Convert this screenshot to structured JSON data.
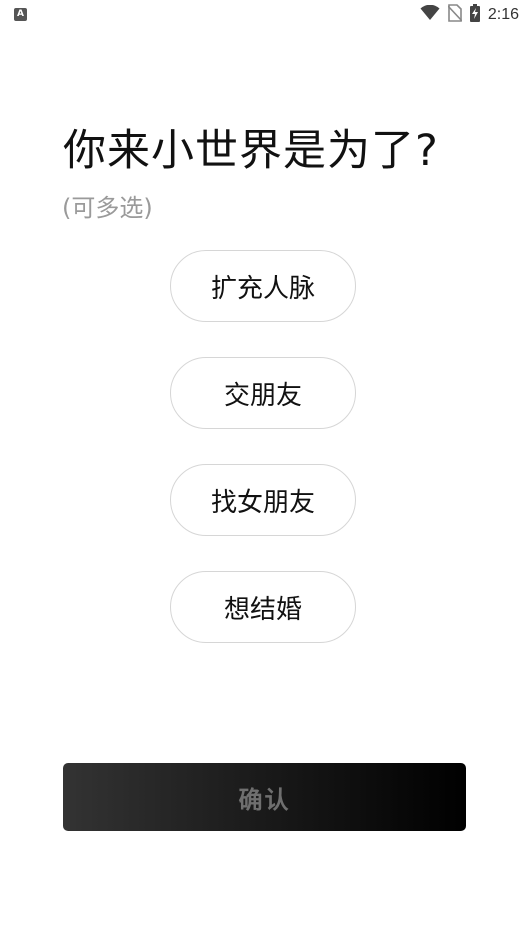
{
  "status_bar": {
    "time": "2:16",
    "left_icon": "A",
    "icons": [
      "wifi-icon",
      "no-sim-icon",
      "battery-charging-icon"
    ]
  },
  "header": {
    "title": "你来小世界是为了?",
    "subtitle": "(可多选)"
  },
  "options": [
    {
      "label": "扩充人脉"
    },
    {
      "label": "交朋友"
    },
    {
      "label": "找女朋友"
    },
    {
      "label": "想结婚"
    }
  ],
  "confirm": {
    "label": "确认"
  }
}
